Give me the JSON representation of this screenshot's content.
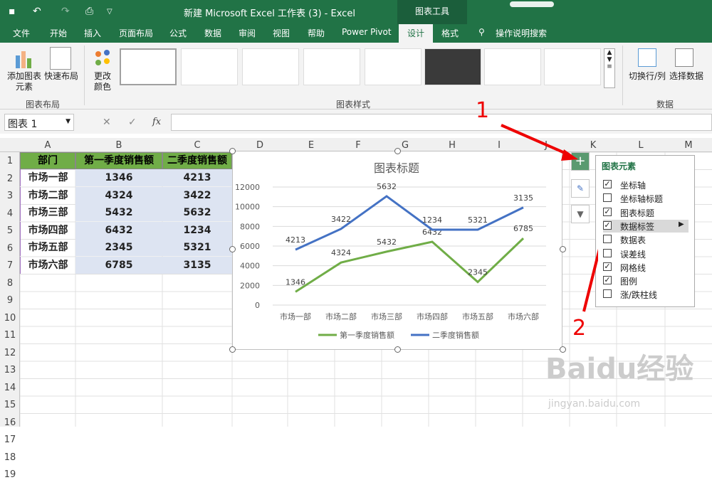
{
  "app": {
    "title": "新建 Microsoft Excel 工作表 (3)  -  Excel",
    "chart_tools": "图表工具"
  },
  "tabs": [
    "文件",
    "开始",
    "插入",
    "页面布局",
    "公式",
    "数据",
    "审阅",
    "视图",
    "帮助",
    "Power Pivot",
    "设计",
    "格式",
    "操作说明搜索"
  ],
  "ribbon": {
    "add_element": "添加图表\n元素",
    "quick_layout": "快速布局",
    "change_color": "更改\n颜色",
    "switch": "切换行/列",
    "select_data": "选择数据",
    "group_layout": "图表布局",
    "group_styles": "图表样式",
    "group_data": "数据"
  },
  "formula_bar": {
    "name_box": "图表 1",
    "fx": "fx",
    "value": ""
  },
  "columns": [
    "A",
    "B",
    "C",
    "D",
    "E",
    "F",
    "G",
    "H",
    "I",
    "J",
    "K",
    "L",
    "M"
  ],
  "rows": [
    "1",
    "2",
    "3",
    "4",
    "5",
    "6",
    "7",
    "8",
    "9",
    "10",
    "11",
    "12",
    "13",
    "14",
    "15",
    "16",
    "17",
    "18",
    "19"
  ],
  "table": {
    "headers": [
      "部门",
      "第一季度销售额",
      "二季度销售额"
    ],
    "rows": [
      [
        "市场一部",
        "1346",
        "4213"
      ],
      [
        "市场二部",
        "4324",
        "3422"
      ],
      [
        "市场三部",
        "5432",
        "5632"
      ],
      [
        "市场四部",
        "6432",
        "1234"
      ],
      [
        "市场五部",
        "2345",
        "5321"
      ],
      [
        "市场六部",
        "6785",
        "3135"
      ]
    ]
  },
  "chart_data": {
    "type": "line",
    "title": "图表标题",
    "categories": [
      "市场一部",
      "市场二部",
      "市场三部",
      "市场四部",
      "市场五部",
      "市场六部"
    ],
    "y_ticks": [
      "0",
      "2000",
      "4000",
      "6000",
      "8000",
      "10000",
      "12000"
    ],
    "series": [
      {
        "name": "第一季度销售额",
        "values": [
          1346,
          4324,
          5432,
          6432,
          2345,
          6785
        ],
        "color": "#70ad47"
      },
      {
        "name": "二季度销售额",
        "values": [
          5632,
          7746,
          11064,
          7666,
          7666,
          9920
        ],
        "color": "#4472c4"
      }
    ],
    "series2_data_labels": [
      "4213",
      "3422",
      "5632",
      "1234",
      "5321",
      "3135"
    ],
    "ylim": [
      0,
      12000
    ],
    "grid": true,
    "legend": "bottom"
  },
  "elements_panel": {
    "title": "图表元素",
    "items": [
      {
        "label": "坐标轴",
        "checked": true
      },
      {
        "label": "坐标轴标题",
        "checked": false
      },
      {
        "label": "图表标题",
        "checked": true
      },
      {
        "label": "数据标签",
        "checked": true
      },
      {
        "label": "数据表",
        "checked": false
      },
      {
        "label": "误差线",
        "checked": false
      },
      {
        "label": "网格线",
        "checked": true
      },
      {
        "label": "图例",
        "checked": true
      },
      {
        "label": "涨/跌柱线",
        "checked": false
      }
    ]
  },
  "annotations": {
    "one": "1",
    "two": "2"
  },
  "watermark": {
    "brand": "Baidu经验",
    "url": "jingyan.baidu.com"
  }
}
